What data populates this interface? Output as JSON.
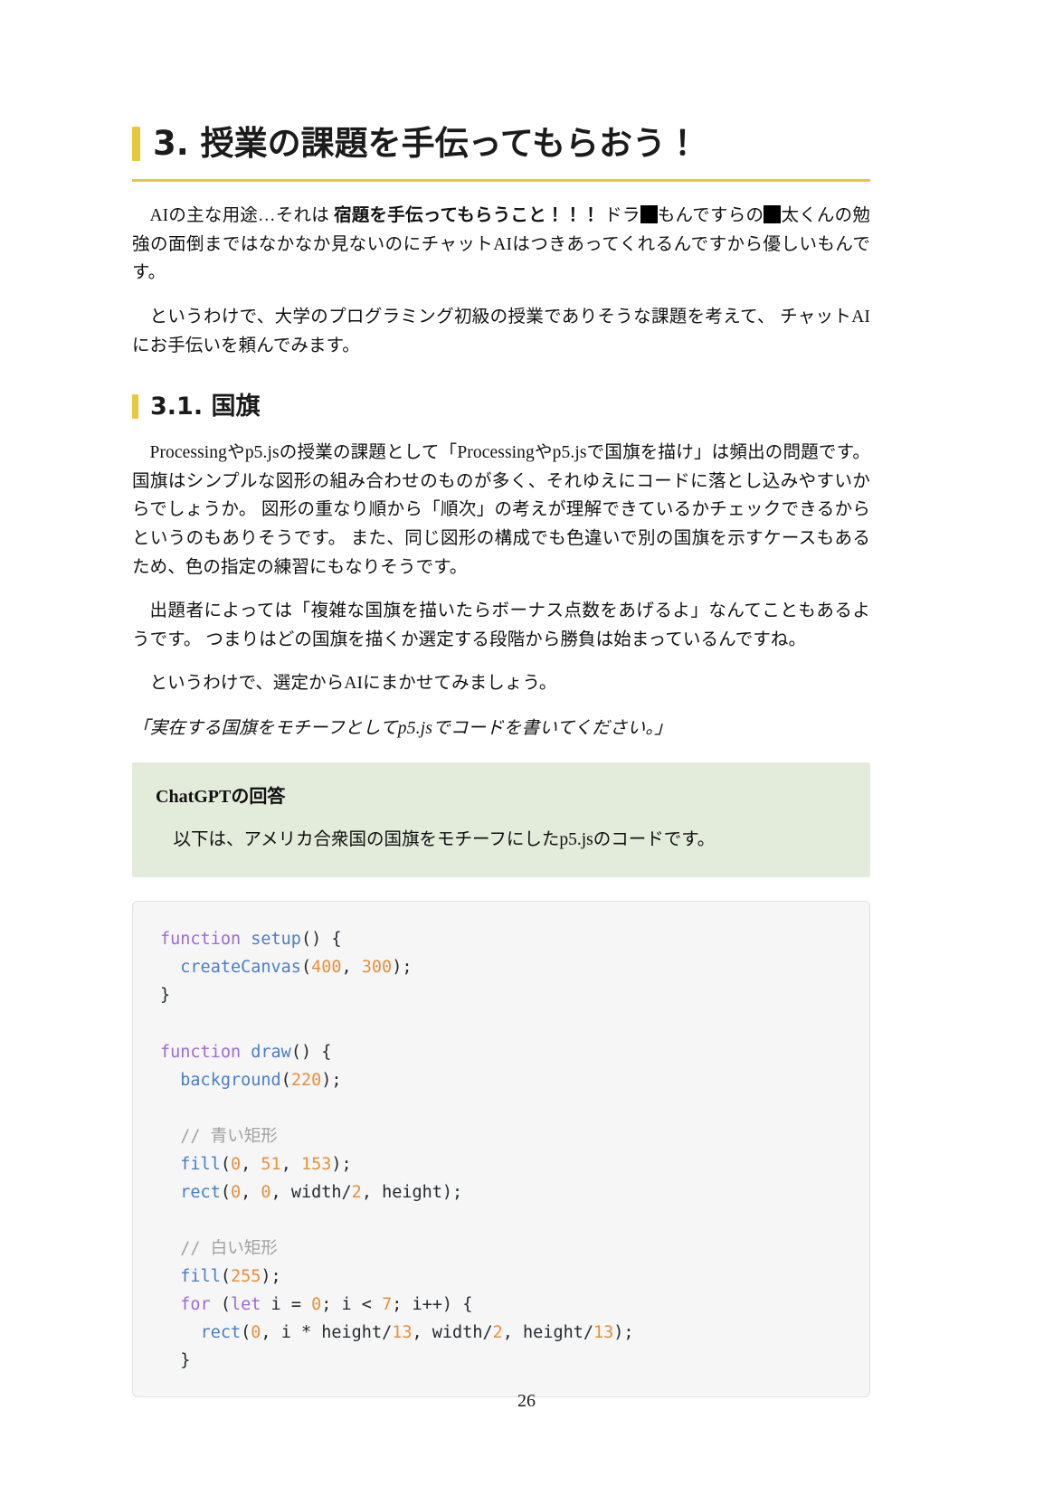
{
  "page": {
    "number": "26",
    "accent_color": "#e8c83c",
    "answer_box_color": "#e3ecdb",
    "code_bg_color": "#f6f6f6"
  },
  "heading": {
    "h1": "3. 授業の課題を手伝ってもらおう！",
    "h2": "3.1. 国旗"
  },
  "paragraphs": {
    "p1_a": "AIの主な用途…それは ",
    "p1_bold": "宿題を手伝ってもらうこと！！！",
    "p1_b": " ドラ",
    "p1_redact1": "■",
    "p1_c": "もんですらの",
    "p1_redact2": "■",
    "p1_d": "太くんの勉強の面倒まではなかなか見ないのにチャットAIはつきあってくれるんですから優しいもんです。",
    "p2": "というわけで、大学のプログラミング初級の授業でありそうな課題を考えて、 チャットAIにお手伝いを頼んでみます。",
    "p3": "Processingやp5.jsの授業の課題として「Processingやp5.jsで国旗を描け」は頻出の問題です。 国旗はシンプルな図形の組み合わせのものが多く、それゆえにコードに落とし込みやすいからでしょうか。 図形の重なり順から「順次」の考えが理解できているかチェックできるからというのもありそうです。 また、同じ図形の構成でも色違いで別の国旗を示すケースもあるため、色の指定の練習にもなりそうです。",
    "p4": "出題者によっては「複雑な国旗を描いたらボーナス点数をあげるよ」なんてこともあるようです。 つまりはどの国旗を描くか選定する段階から勝負は始まっているんですね。",
    "p5": "というわけで、選定からAIにまかせてみましょう。",
    "prompt": "「実在する国旗をモチーフとしてp5.jsでコードを書いてください。」"
  },
  "answer_box": {
    "title": "ChatGPTの回答",
    "body": "以下は、アメリカ合衆国の国旗をモチーフにしたp5.jsのコードです。"
  },
  "code": {
    "language": "javascript",
    "lines": [
      "function setup() {",
      "  createCanvas(400, 300);",
      "}",
      "",
      "function draw() {",
      "  background(220);",
      "",
      "  // 青い矩形",
      "  fill(0, 51, 153);",
      "  rect(0, 0, width/2, height);",
      "",
      "  // 白い矩形",
      "  fill(255);",
      "  for (let i = 0; i < 7; i++) {",
      "    rect(0, i * height/13, width/2, height/13);",
      "  }"
    ]
  }
}
